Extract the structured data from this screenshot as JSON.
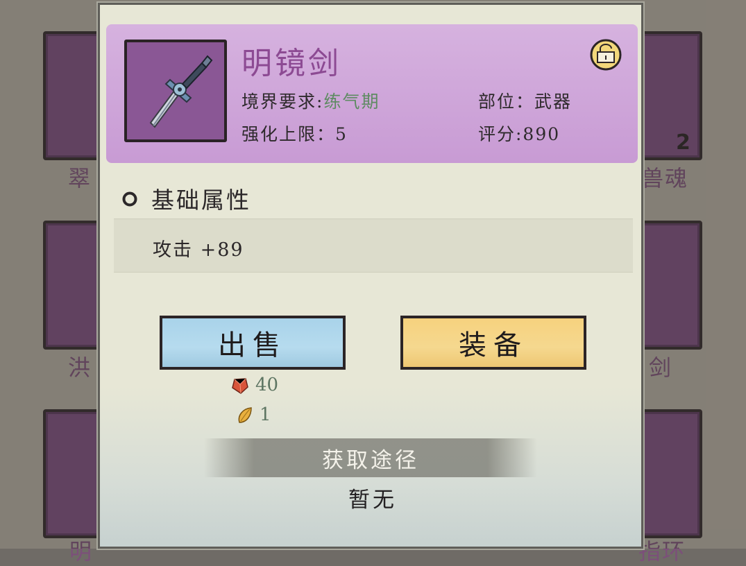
{
  "background": {
    "labels": {
      "left_row1": "翠",
      "right_row1": "兽魂",
      "left_row2": "洪",
      "right_row2": "剑",
      "left_row3": "明",
      "right_row3": "指环"
    },
    "count_badge": "2"
  },
  "item": {
    "name": "明镜剑",
    "icon": "sword-icon",
    "lock_icon": "lock-icon",
    "realm_label": "境界要求:",
    "realm_value": "练气期",
    "slot_text": "部位：武器",
    "enhance_text": "强化上限：5",
    "score_text": "评分:890"
  },
  "attributes": {
    "title": "基础属性",
    "lines": [
      "攻击 +89"
    ]
  },
  "actions": {
    "sell_label": "出售",
    "equip_label": "装备"
  },
  "sell_rewards": [
    {
      "icon": "red-gem-icon",
      "amount": "40"
    },
    {
      "icon": "gold-leaf-icon",
      "amount": "1"
    }
  ],
  "source": {
    "title": "获取途径",
    "value": "暂无"
  },
  "colors": {
    "header_purple": "#c89bd4",
    "name_purple": "#8c4a93",
    "realm_green": "#5e8b62",
    "sell_blue": "#a9d3ea",
    "equip_gold": "#f6d27e"
  }
}
